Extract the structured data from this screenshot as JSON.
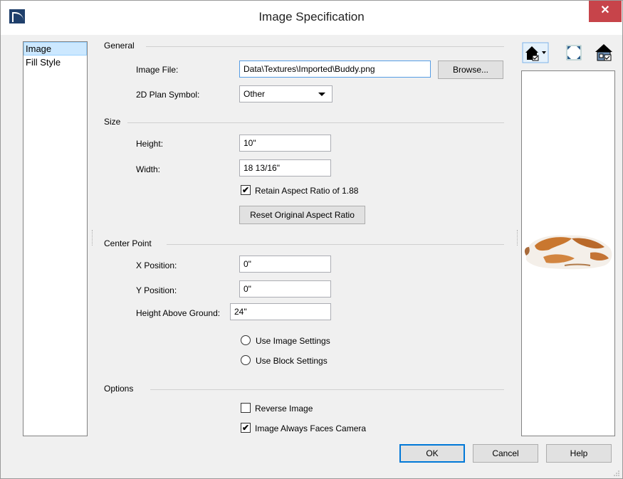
{
  "window": {
    "title": "Image Specification",
    "close_glyph": "✕"
  },
  "nav": {
    "items": [
      {
        "label": "Image",
        "selected": true
      },
      {
        "label": "Fill Style",
        "selected": false
      }
    ]
  },
  "general": {
    "section_label": "General",
    "image_file_label": "Image File:",
    "image_file_value": "Data\\Textures\\Imported\\Buddy.png",
    "browse_label": "Browse...",
    "plan_symbol_label": "2D Plan Symbol:",
    "plan_symbol_value": "Other"
  },
  "size": {
    "section_label": "Size",
    "height_label": "Height:",
    "height_value": "10\"",
    "width_label": "Width:",
    "width_value": "18 13/16\"",
    "retain_label": "Retain Aspect Ratio of 1.88",
    "retain_checked": true,
    "reset_label": "Reset Original Aspect Ratio"
  },
  "center_point": {
    "section_label": "Center Point",
    "x_label": "X Position:",
    "x_value": "0\"",
    "y_label": "Y Position:",
    "y_value": "0\"",
    "h_label": "Height Above Ground:",
    "h_value": "24\"",
    "use_image_label": "Use Image Settings",
    "use_block_label": "Use Block Settings"
  },
  "options": {
    "section_label": "Options",
    "reverse_label": "Reverse Image",
    "reverse_checked": false,
    "faces_camera_label": "Image Always Faces Camera",
    "faces_camera_checked": true
  },
  "preview": {
    "toolbar_icons": [
      "house-view-dropdown-icon",
      "fit-to-window-icon",
      "house-render-icon"
    ],
    "image_icon": "sleeping-cat-image"
  },
  "footer": {
    "ok_label": "OK",
    "cancel_label": "Cancel",
    "help_label": "Help"
  },
  "check_glyph": "✔",
  "colors": {
    "accent": "#0078d7",
    "close_red": "#c7444a",
    "selected_bg": "#cce8ff"
  }
}
